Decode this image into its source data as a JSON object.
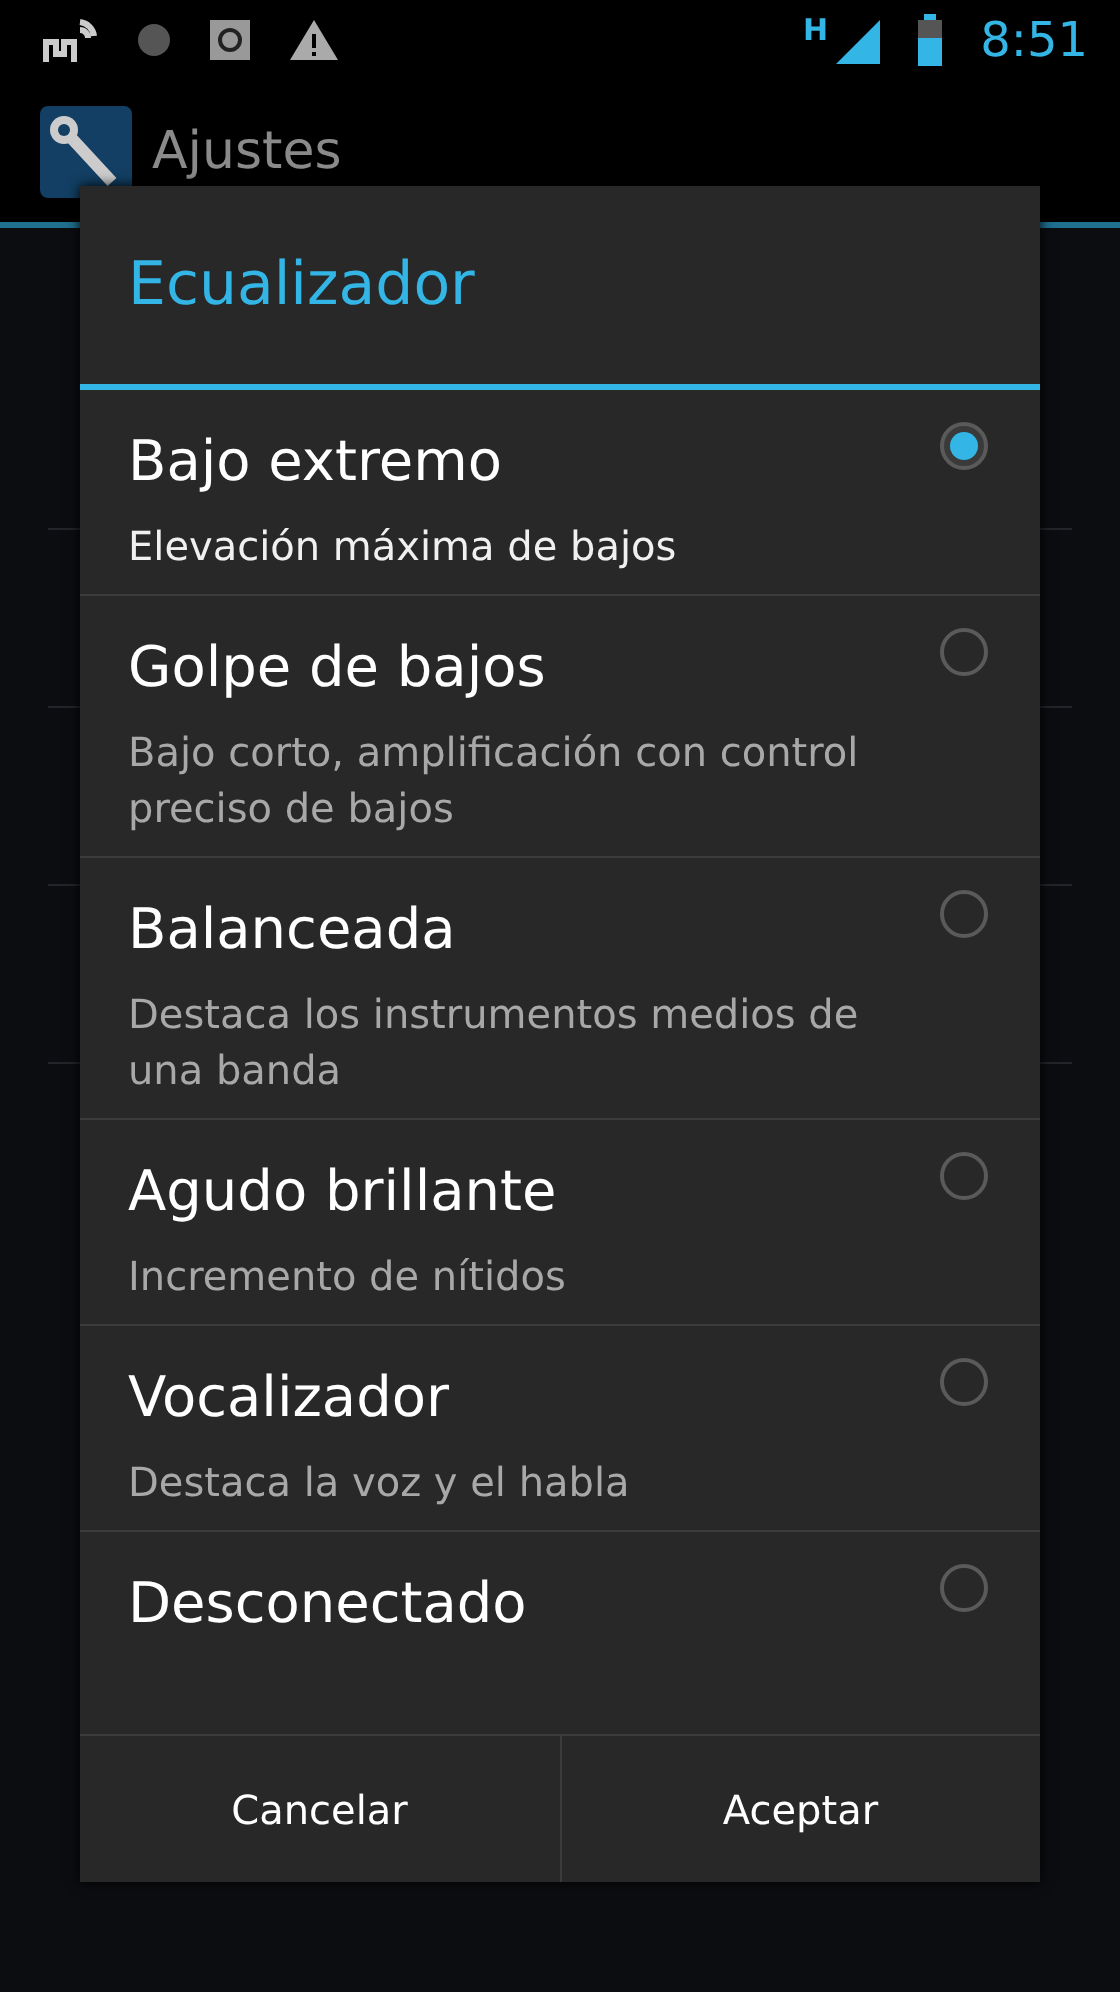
{
  "status_bar": {
    "time": "8:51",
    "network": "H"
  },
  "action_bar": {
    "title": "Ajustes"
  },
  "dialog": {
    "title": "Ecualizador",
    "options": [
      {
        "title": "Bajo extremo",
        "description": "Elevación máxima de bajos",
        "selected": true
      },
      {
        "title": "Golpe de bajos",
        "description": "Bajo corto, amplificación con control preciso de bajos",
        "selected": false
      },
      {
        "title": "Balanceada",
        "description": "Destaca los instrumentos medios de una banda",
        "selected": false
      },
      {
        "title": "Agudo brillante",
        "description": "Incremento de nítidos",
        "selected": false
      },
      {
        "title": "Vocalizador",
        "description": "Destaca la voz y el habla",
        "selected": false
      },
      {
        "title": "Desconectado",
        "selected": false
      }
    ],
    "buttons": [
      "Cancelar",
      "Aceptar"
    ]
  }
}
